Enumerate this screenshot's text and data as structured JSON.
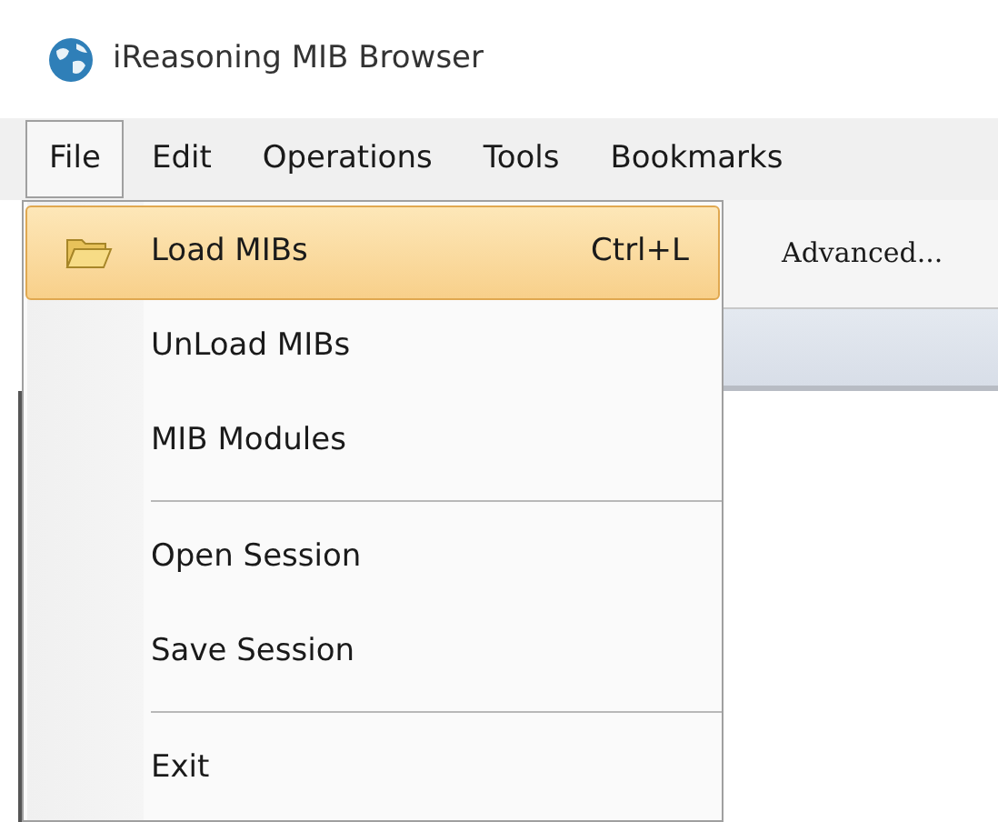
{
  "window": {
    "title": "iReasoning MIB Browser"
  },
  "menu_bar": [
    {
      "label": "File",
      "selected": true
    },
    {
      "label": "Edit",
      "selected": false
    },
    {
      "label": "Operations",
      "selected": false
    },
    {
      "label": "Tools",
      "selected": false
    },
    {
      "label": "Bookmarks",
      "selected": false
    }
  ],
  "file_menu": [
    {
      "kind": "item",
      "label": "Load MIBs",
      "shortcut": "Ctrl+L",
      "selected": true
    },
    {
      "kind": "item",
      "label": "UnLoad MIBs",
      "selected": false
    },
    {
      "kind": "item",
      "label": "MIB Modules",
      "selected": false
    },
    {
      "kind": "separator"
    },
    {
      "kind": "item",
      "label": "Open Session",
      "selected": false
    },
    {
      "kind": "item",
      "label": "Save Session",
      "selected": false
    },
    {
      "kind": "separator"
    },
    {
      "kind": "item",
      "label": "Exit",
      "selected": false
    }
  ],
  "toolbar": {
    "button": "Advanced..."
  }
}
